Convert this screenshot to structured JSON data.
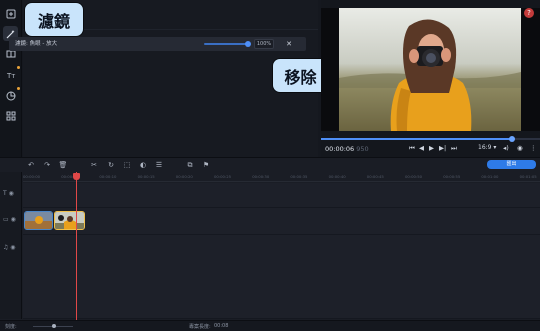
{
  "colors": {
    "accent": "#4f8ff7",
    "callout_bg": "#c9e4fb",
    "playhead": "#e04848",
    "selected_clip_border": "#f0c04a",
    "export": "#2e7be8",
    "help": "#c33b3b"
  },
  "toolbar": {
    "items": [
      {
        "icon": "import-icon"
      },
      {
        "icon": "magic-wand-icon",
        "active": true
      },
      {
        "icon": "transitions-icon"
      },
      {
        "icon": "titles-icon"
      },
      {
        "icon": "stickers-icon"
      },
      {
        "icon": "more-tools-icon"
      }
    ]
  },
  "callouts": {
    "filter": "濾鏡",
    "remove": "移除"
  },
  "filter_row": {
    "name": "濾鏡: 魚眼 - 放大",
    "intensity": "100%",
    "intensity_value": 1.0,
    "remove_symbol": "✕"
  },
  "preview": {
    "help": "?",
    "time_current": "00:00:06",
    "time_total": "950",
    "progress": 0.87,
    "ratio": "16:9 ▾",
    "controls": [
      "⏮",
      "◀",
      "▶",
      "▶|",
      "⏭"
    ]
  },
  "timeline": {
    "export_label": "匯出",
    "ruler_ticks": [
      "00:00:00",
      "00:00:05",
      "00:00:10",
      "00:00:15",
      "00:00:20",
      "00:00:25",
      "00:00:30",
      "00:00:35",
      "00:00:40",
      "00:00:45",
      "00:00:50",
      "00:00:55",
      "00:01:00",
      "00:01:05"
    ],
    "tool_icons": [
      "↶",
      "↷",
      "🗑",
      "✂",
      "↻",
      "⬚",
      "◐",
      "☰",
      "⧉",
      "⚑"
    ]
  },
  "status": {
    "scale_label": "刻度:",
    "duration_label": "專案長度:",
    "duration": "00:08",
    "zoom": 0.5
  }
}
